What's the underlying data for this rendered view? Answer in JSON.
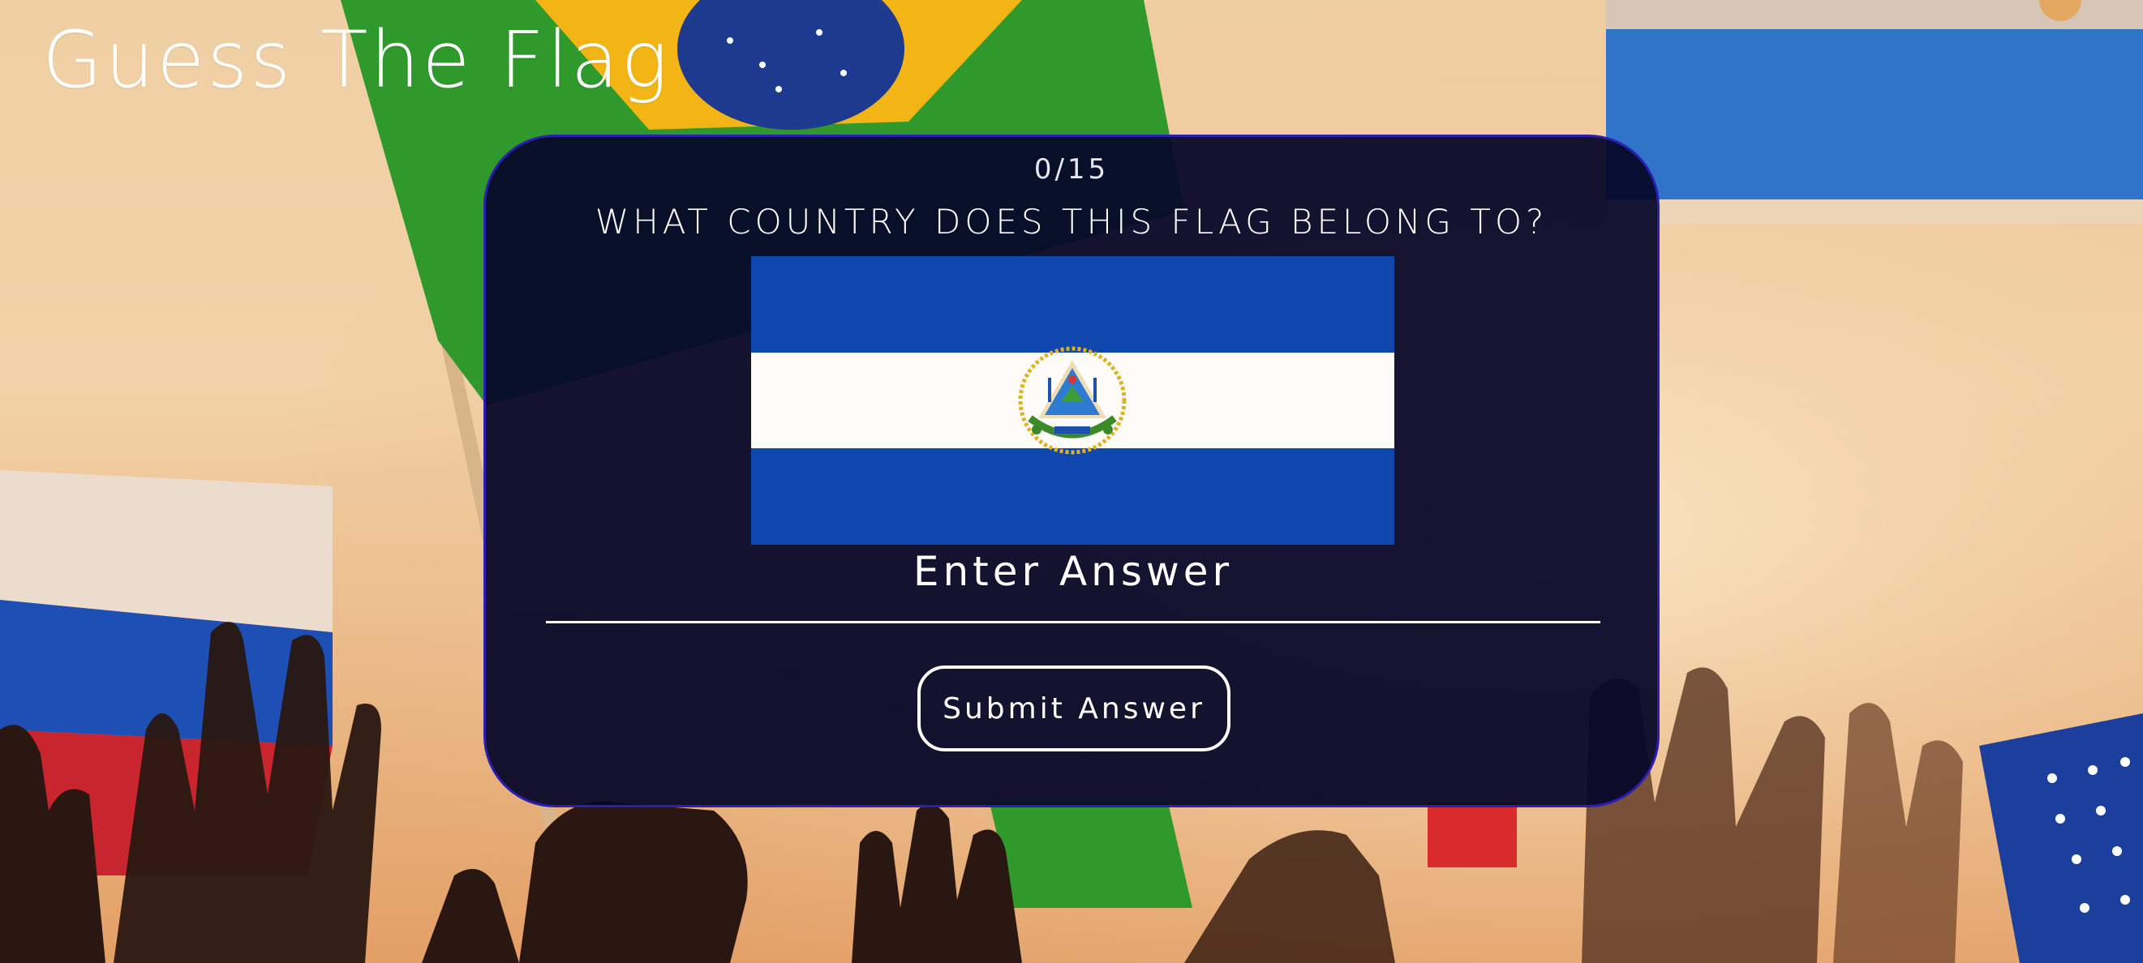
{
  "app": {
    "title": "Guess The Flag"
  },
  "quiz": {
    "progress": "0/15",
    "answered": 0,
    "total": 15,
    "question": "WHAT COUNTRY DOES THIS FLAG BELONG TO?",
    "flag": {
      "icon": "el-salvador-flag",
      "stripe_colors": [
        "#0f47af",
        "#ffffff",
        "#0f47af"
      ]
    },
    "answer_input": {
      "value": "",
      "placeholder": "Enter Answer"
    },
    "submit_label": "Submit Answer"
  },
  "theme": {
    "card_background": "#06062a",
    "card_border": "#2a1fb0",
    "text_color": "#ffffff"
  }
}
